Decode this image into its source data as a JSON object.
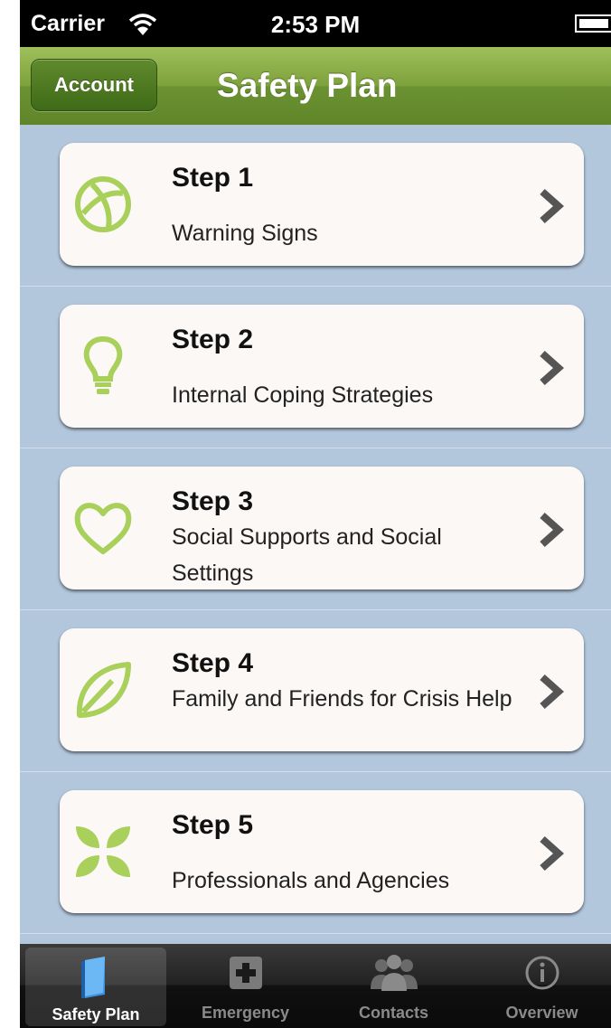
{
  "status_bar": {
    "carrier": "Carrier",
    "time": "2:53 PM"
  },
  "nav": {
    "title": "Safety Plan",
    "account_label": "Account"
  },
  "steps": [
    {
      "title": "Step 1",
      "subtitle": "Warning Signs",
      "icon": "globe-icon"
    },
    {
      "title": "Step 2",
      "subtitle": "Internal Coping Strategies",
      "icon": "lightbulb-icon"
    },
    {
      "title": "Step 3",
      "subtitle": "Social Supports and Social Settings",
      "icon": "heart-icon"
    },
    {
      "title": "Step 4",
      "subtitle": "Family and Friends for Crisis Help",
      "icon": "leaf-icon"
    },
    {
      "title": "Step 5",
      "subtitle": "Professionals and Agencies",
      "icon": "flower-icon"
    }
  ],
  "tabs": [
    {
      "label": "Safety Plan",
      "icon": "book-icon",
      "active": true
    },
    {
      "label": "Emergency",
      "icon": "medical-cross-icon",
      "active": false
    },
    {
      "label": "Contacts",
      "icon": "people-icon",
      "active": false
    },
    {
      "label": "Overview",
      "icon": "info-icon",
      "active": false
    }
  ],
  "colors": {
    "accent_green": "#a8d05a",
    "nav_green": "#7da13c",
    "background_blue": "#b2c6dc"
  }
}
